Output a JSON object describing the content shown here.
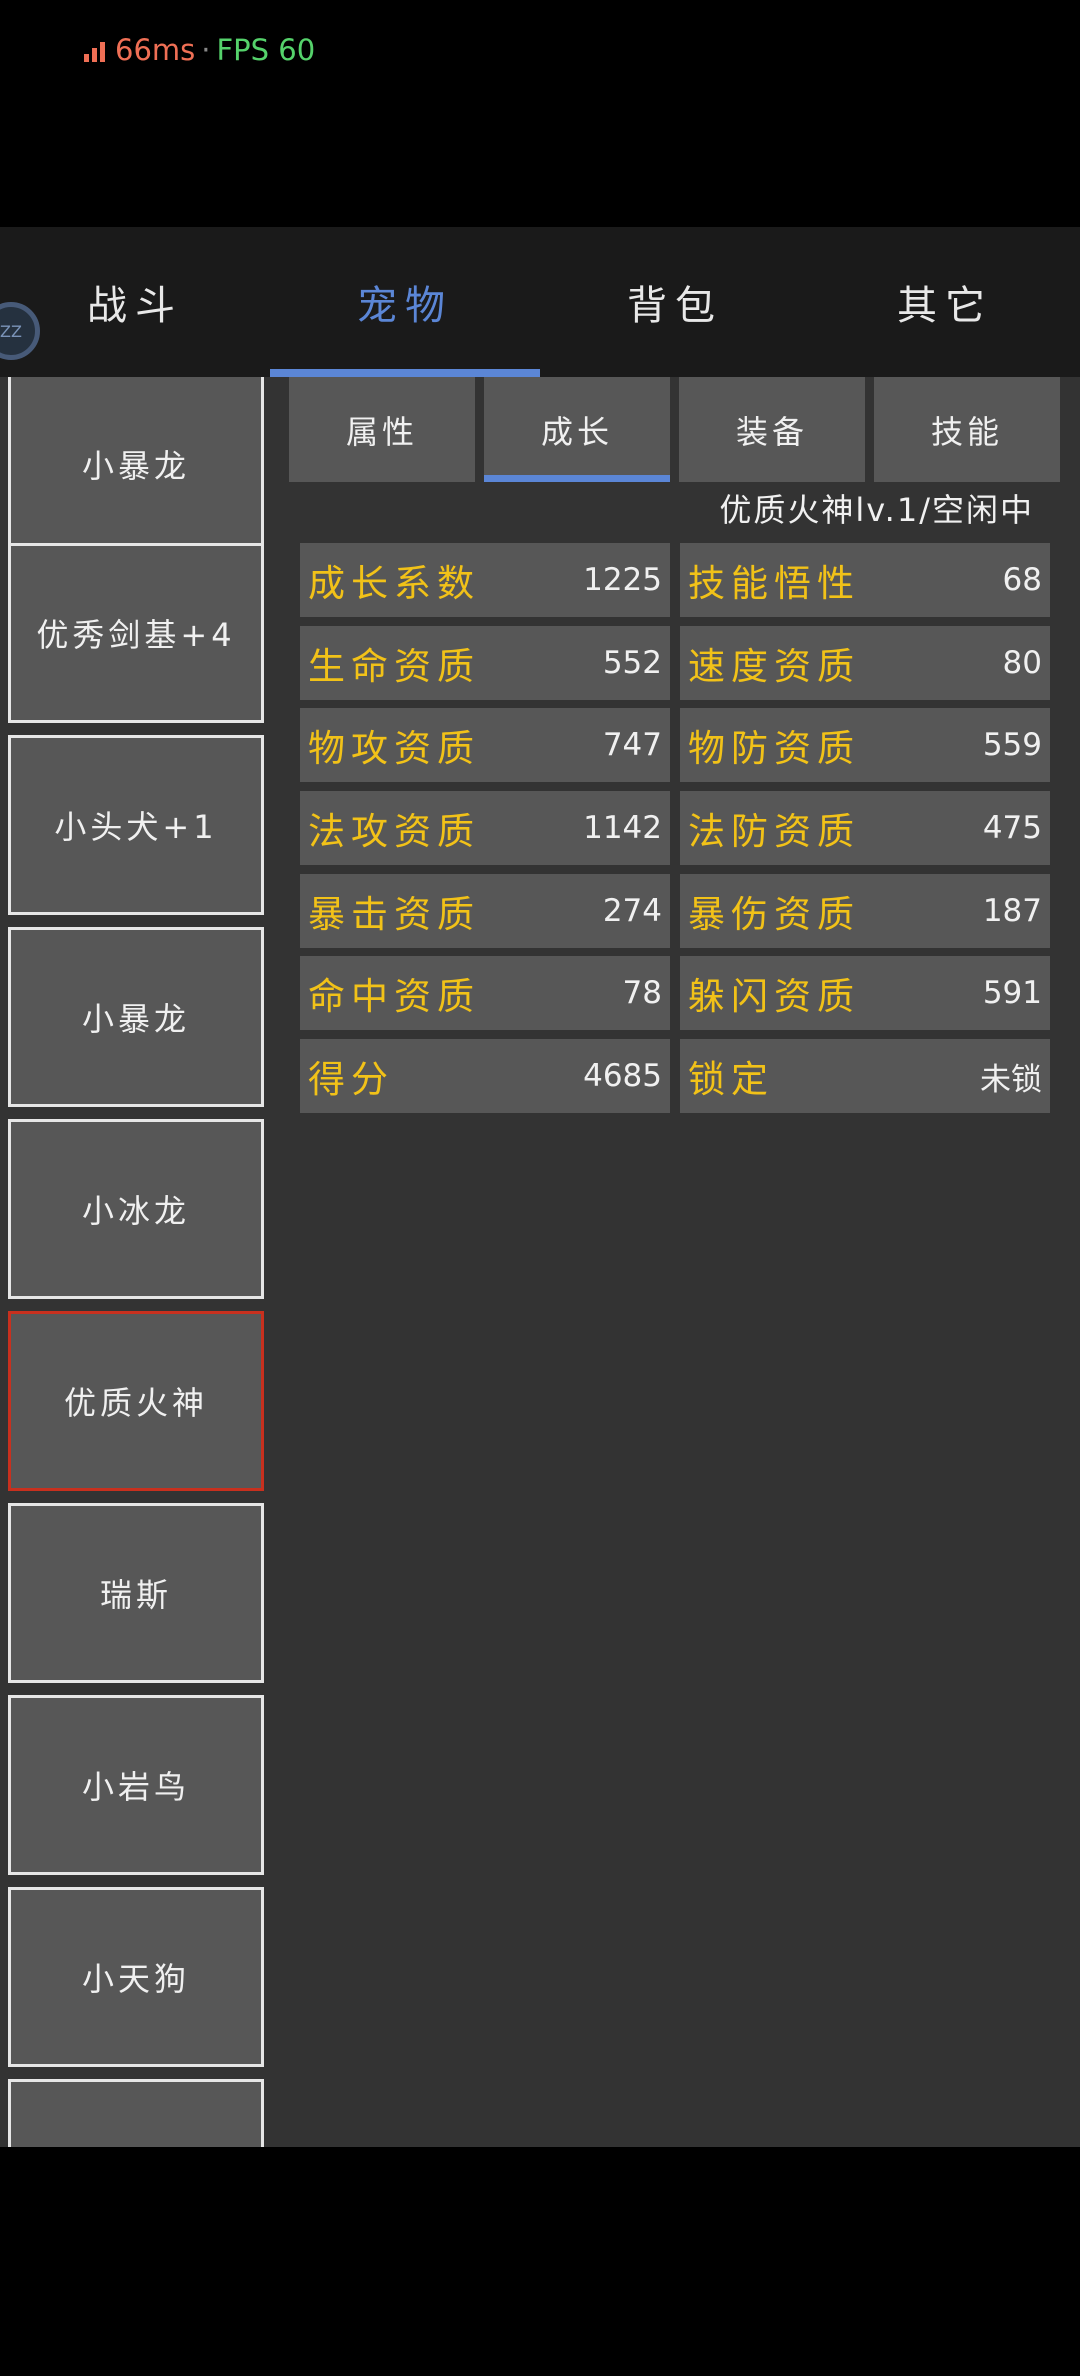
{
  "status_bar": {
    "ping": "66ms",
    "separator": "·",
    "fps": "FPS 60"
  },
  "avatar_text": "ZZ",
  "top_tabs": [
    {
      "label": "战斗",
      "active": false
    },
    {
      "label": "宠物",
      "active": true
    },
    {
      "label": "背包",
      "active": false
    },
    {
      "label": "其它",
      "active": false
    }
  ],
  "pet_list": [
    {
      "name": "小暴龙"
    },
    {
      "name": "优秀剑基+4"
    },
    {
      "name": "小头犬+1"
    },
    {
      "name": "小暴龙"
    },
    {
      "name": "小冰龙"
    },
    {
      "name": "优质火神",
      "selected": true
    },
    {
      "name": "瑞斯"
    },
    {
      "name": "小岩鸟"
    },
    {
      "name": "小天狗"
    },
    {
      "name": ""
    }
  ],
  "sub_tabs": [
    {
      "label": "属性",
      "active": false
    },
    {
      "label": "成长",
      "active": true
    },
    {
      "label": "装备",
      "active": false
    },
    {
      "label": "技能",
      "active": false
    }
  ],
  "pet_status": "优质火神lv.1/空闲中",
  "stats": [
    [
      {
        "label": "成长系数",
        "value": "1225"
      },
      {
        "label": "技能悟性",
        "value": "68"
      }
    ],
    [
      {
        "label": "生命资质",
        "value": "552"
      },
      {
        "label": "速度资质",
        "value": "80"
      }
    ],
    [
      {
        "label": "物攻资质",
        "value": "747"
      },
      {
        "label": "物防资质",
        "value": "559"
      }
    ],
    [
      {
        "label": "法攻资质",
        "value": "1142"
      },
      {
        "label": "法防资质",
        "value": "475"
      }
    ],
    [
      {
        "label": "暴击资质",
        "value": "274"
      },
      {
        "label": "暴伤资质",
        "value": "187"
      }
    ],
    [
      {
        "label": "命中资质",
        "value": "78"
      },
      {
        "label": "躲闪资质",
        "value": "591"
      }
    ],
    [
      {
        "label": "得分",
        "value": "4685"
      },
      {
        "label": "锁定",
        "value": "未锁"
      }
    ]
  ],
  "colors": {
    "accent": "#5b86d6",
    "label": "#f2c218",
    "selected_border": "#c8301e",
    "panel": "#333333",
    "cell": "#575757"
  }
}
